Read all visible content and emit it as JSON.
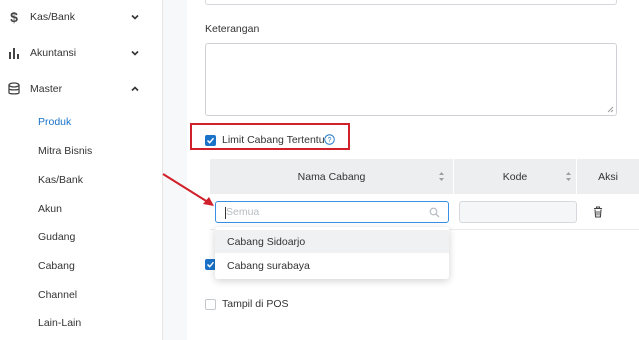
{
  "sidebar": {
    "groups": [
      {
        "label": "Kas/Bank",
        "icon": "dollar-icon",
        "expanded": false
      },
      {
        "label": "Akuntansi",
        "icon": "bar-chart-icon",
        "expanded": false
      },
      {
        "label": "Master",
        "icon": "database-icon",
        "expanded": true
      }
    ],
    "items": [
      {
        "label": "Produk",
        "active": true
      },
      {
        "label": "Mitra Bisnis"
      },
      {
        "label": "Kas/Bank"
      },
      {
        "label": "Akun"
      },
      {
        "label": "Gudang"
      },
      {
        "label": "Cabang"
      },
      {
        "label": "Channel"
      },
      {
        "label": "Lain-Lain"
      }
    ]
  },
  "form": {
    "keterangan_label": "Keterangan",
    "keterangan_value": "",
    "limit_cabang_label": "Limit Cabang Tertentu",
    "limit_cabang_checked": true,
    "tampil_pos_label": "Tampil di POS",
    "tampil_pos_checked": false,
    "second_checkbox_checked": true
  },
  "table": {
    "headers": [
      "Nama Cabang",
      "Kode",
      "Aksi"
    ],
    "search_placeholder": "Semua",
    "kode_value": ""
  },
  "dropdown": {
    "options": [
      "Cabang Sidoarjo",
      "Cabang surabaya"
    ]
  },
  "colors": {
    "accent": "#1a73c8",
    "highlight": "#d0202a"
  }
}
